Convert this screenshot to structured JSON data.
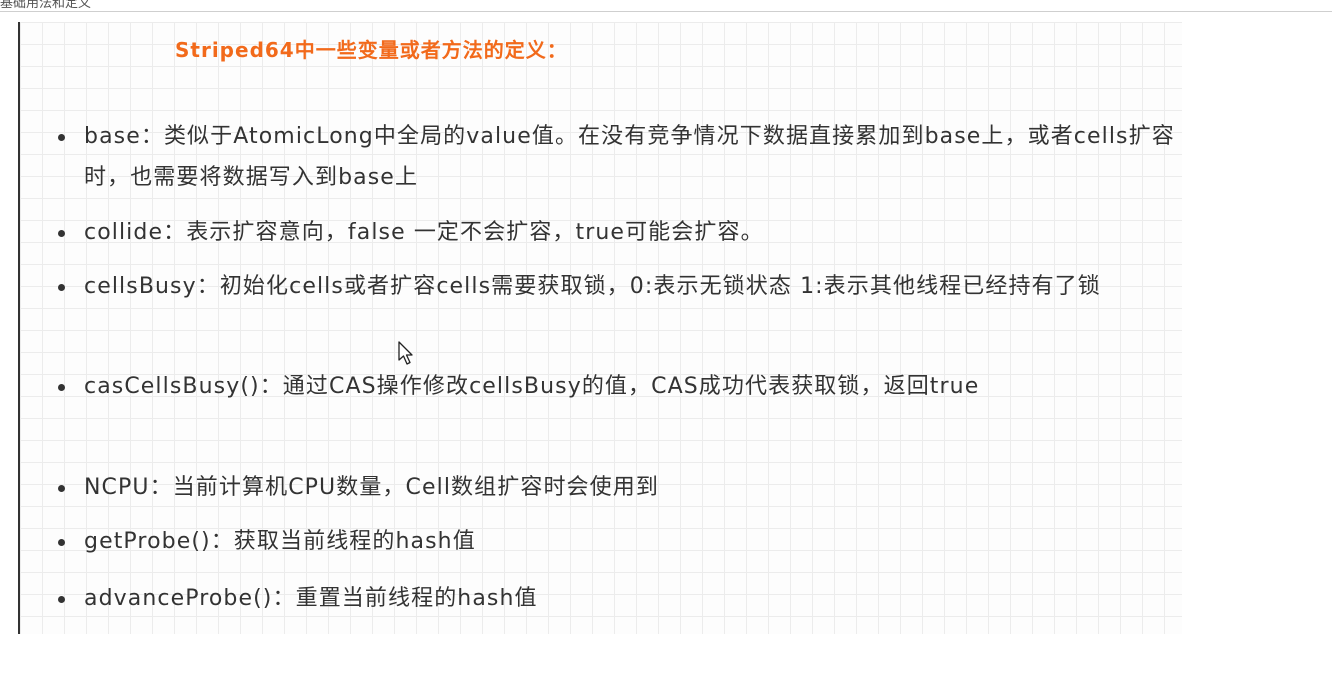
{
  "topbar": {
    "fragment": "基础用法和定义"
  },
  "heading": "Striped64中一些变量或者方法的定义：",
  "items": [
    {
      "text": "base：类似于AtomicLong中全局的value值。在没有竞争情况下数据直接累加到base上，或者cells扩容时，也需要将数据写入到base上"
    },
    {
      "text": "collide：表示扩容意向，false 一定不会扩容，true可能会扩容。"
    },
    {
      "text": "cellsBusy：初始化cells或者扩容cells需要获取锁，0:表示无锁状态 1:表示其他线程已经持有了锁"
    },
    {
      "text": "casCellsBusy()：通过CAS操作修改cellsBusy的值，CAS成功代表获取锁，返回true"
    },
    {
      "text": "NCPU：当前计算机CPU数量，Cell数组扩容时会使用到"
    },
    {
      "text": "getProbe()：获取当前线程的hash值"
    },
    {
      "text": "advanceProbe()：重置当前线程的hash值"
    }
  ]
}
